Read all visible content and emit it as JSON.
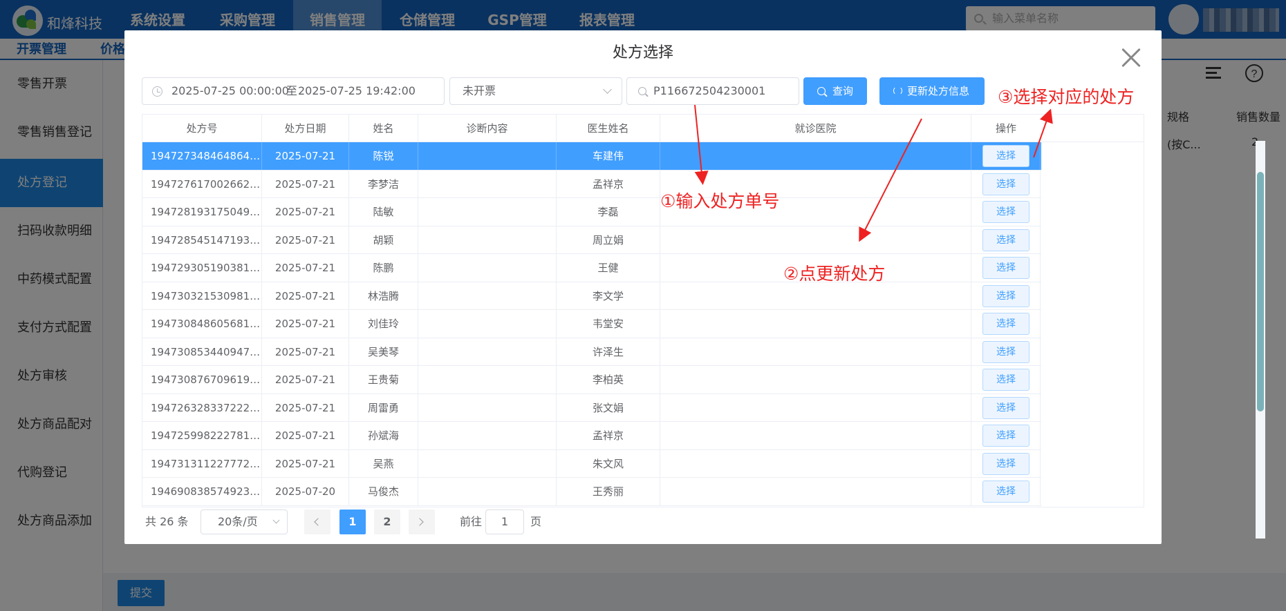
{
  "app": {
    "brand": "和烽科技",
    "top_menu": [
      "系统设置",
      "采购管理",
      "销售管理",
      "仓储管理",
      "GSP管理",
      "报表管理"
    ],
    "menu_search_placeholder": "输入菜单名称",
    "sub_tabs": [
      "开票管理",
      "价格"
    ],
    "sidebar": [
      "零售开票",
      "零售销售登记",
      "处方登记",
      "扫码收款明细",
      "中药模式配置",
      "支付方式配置",
      "处方审核",
      "处方商品配对",
      "代购登记",
      "处方商品添加"
    ],
    "bg_table": {
      "headers": [
        "规格",
        "销售数量"
      ],
      "row": [
        "(按C...",
        "2"
      ]
    },
    "submit_label": "提交"
  },
  "dialog": {
    "title": "处方选择",
    "date_start": "2025-07-25 00:00:00",
    "date_sep": "至",
    "date_end": "2025-07-25 19:42:00",
    "status_select": "未开票",
    "rx_no_input": "P116672504230001",
    "query_label": "查询",
    "refresh_label": "更新处方信息",
    "table": {
      "headers": [
        "处方号",
        "处方日期",
        "姓名",
        "诊断内容",
        "医生姓名",
        "就诊医院",
        "操作"
      ],
      "action_label": "选择",
      "rows": [
        {
          "no": "1947273484648640...",
          "date": "2025-07-21",
          "name": "陈锐",
          "diag": "",
          "doctor": "车建伟",
          "hospital": ""
        },
        {
          "no": "1947276170026627...",
          "date": "2025-07-21",
          "name": "李梦洁",
          "diag": "",
          "doctor": "孟祥京",
          "hospital": ""
        },
        {
          "no": "1947281931750490...",
          "date": "2025-07-21",
          "name": "陆敏",
          "diag": "",
          "doctor": "李磊",
          "hospital": ""
        },
        {
          "no": "1947285451471937...",
          "date": "2025-07-21",
          "name": "胡颖",
          "diag": "",
          "doctor": "周立娟",
          "hospital": ""
        },
        {
          "no": "1947293051903819...",
          "date": "2025-07-21",
          "name": "陈鹏",
          "diag": "",
          "doctor": "王健",
          "hospital": ""
        },
        {
          "no": "1947303215309811...",
          "date": "2025-07-21",
          "name": "林浩腾",
          "diag": "",
          "doctor": "李文学",
          "hospital": ""
        },
        {
          "no": "1947308486056816...",
          "date": "2025-07-21",
          "name": "刘佳玲",
          "diag": "",
          "doctor": "韦堂安",
          "hospital": ""
        },
        {
          "no": "1947308534409478...",
          "date": "2025-07-21",
          "name": "吴美琴",
          "diag": "",
          "doctor": "许泽生",
          "hospital": ""
        },
        {
          "no": "1947308767096193...",
          "date": "2025-07-21",
          "name": "王贵菊",
          "diag": "",
          "doctor": "李柏英",
          "hospital": ""
        },
        {
          "no": "1947263283372224...",
          "date": "2025-07-21",
          "name": "周雷勇",
          "diag": "",
          "doctor": "张文娟",
          "hospital": ""
        },
        {
          "no": "1947259982227812...",
          "date": "2025-07-21",
          "name": "孙斌海",
          "diag": "",
          "doctor": "孟祥京",
          "hospital": ""
        },
        {
          "no": "1947313112277729...",
          "date": "2025-07-21",
          "name": "吴燕",
          "diag": "",
          "doctor": "朱文风",
          "hospital": ""
        },
        {
          "no": "1946908385749233...",
          "date": "2025-07-20",
          "name": "马俊杰",
          "diag": "",
          "doctor": "王秀丽",
          "hospital": ""
        }
      ]
    },
    "pagination": {
      "total": "共 26 条",
      "page_size": "20条/页",
      "pages": [
        "1",
        "2"
      ],
      "current_page": "1",
      "goto_label": "前往",
      "goto_value": "1",
      "page_suffix": "页"
    }
  },
  "annotations": {
    "step1": "①输入处方单号",
    "step2": "②点更新处方",
    "step3": "③选择对应的处方",
    "color": "#ee2222"
  },
  "colors": {
    "nav": "#1565c0",
    "primary": "#409eff",
    "sidebar_active": "#1e88e5"
  }
}
